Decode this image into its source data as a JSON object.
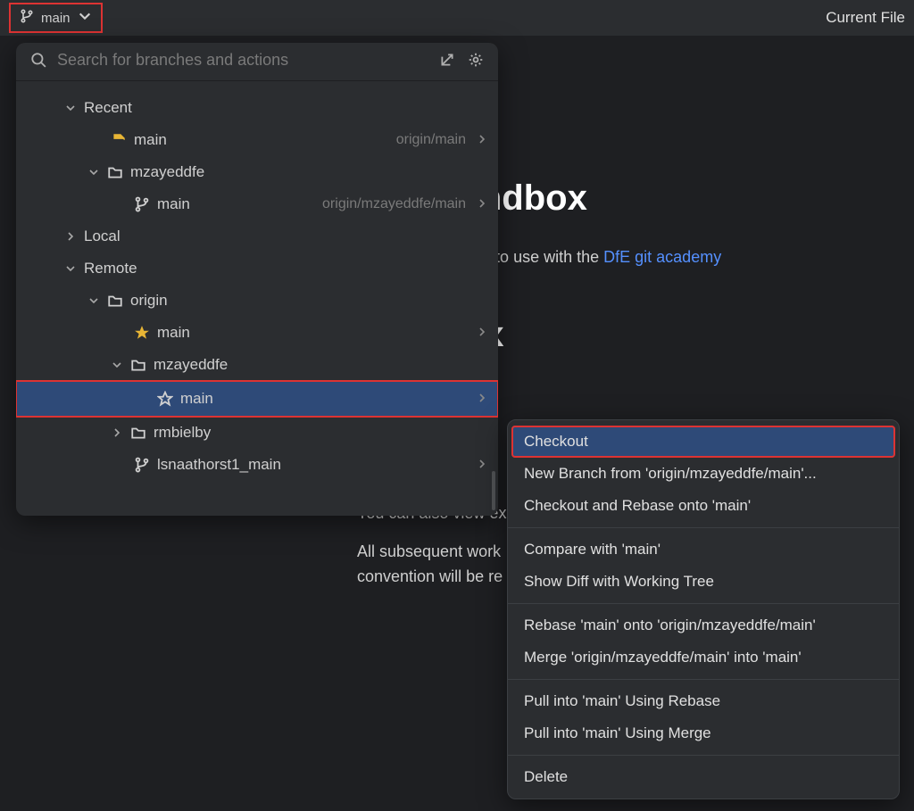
{
  "topbar": {
    "branch_label": "main",
    "right_label": "Current File"
  },
  "search": {
    "placeholder": "Search for branches and actions"
  },
  "sections": {
    "recent": "Recent",
    "local": "Local",
    "remote": "Remote"
  },
  "recent": {
    "main": {
      "label": "main",
      "tracking": "origin/main"
    },
    "folder": {
      "label": "mzayeddfe"
    },
    "branch": {
      "label": "main",
      "tracking": "origin/mzayeddfe/main"
    }
  },
  "remote": {
    "origin": "origin",
    "main": "main",
    "folder1": "mzayeddfe",
    "folder1_main": "main",
    "folder2": "rmbielby",
    "branch_last": "lsnaathorst1_main"
  },
  "content": {
    "h1a_suffix": "emy-sandbox",
    "p1_prefix": "ository for analysts to use with the ",
    "link": "DfE git academy",
    "h1b_suffix": " sandbox",
    "p2": "You can also view ex",
    "p3a": "All subsequent work",
    "p3b": "convention will be re"
  },
  "ctx": {
    "items": [
      "Checkout",
      "New Branch from 'origin/mzayeddfe/main'...",
      "Checkout and Rebase onto 'main'",
      "Compare with 'main'",
      "Show Diff with Working Tree",
      "Rebase 'main' onto 'origin/mzayeddfe/main'",
      "Merge 'origin/mzayeddfe/main' into 'main'",
      "Pull into 'main' Using Rebase",
      "Pull into 'main' Using Merge",
      "Delete"
    ]
  }
}
